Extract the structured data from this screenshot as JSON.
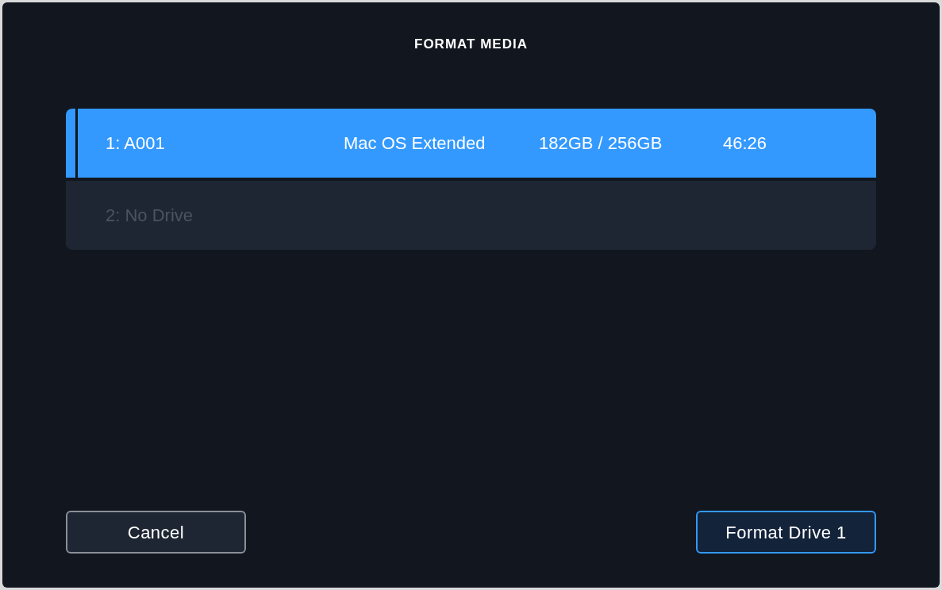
{
  "dialog": {
    "title": "FORMAT MEDIA"
  },
  "drives": [
    {
      "label": "1: A001",
      "format": "Mac OS Extended",
      "capacity": "182GB / 256GB",
      "time": "46:26",
      "selected": true,
      "disabled": false
    },
    {
      "label": "2: No Drive",
      "selected": false,
      "disabled": true
    }
  ],
  "buttons": [
    {
      "label": "Cancel",
      "kind": "secondary"
    },
    {
      "label": "Format Drive 1",
      "kind": "primary"
    }
  ]
}
